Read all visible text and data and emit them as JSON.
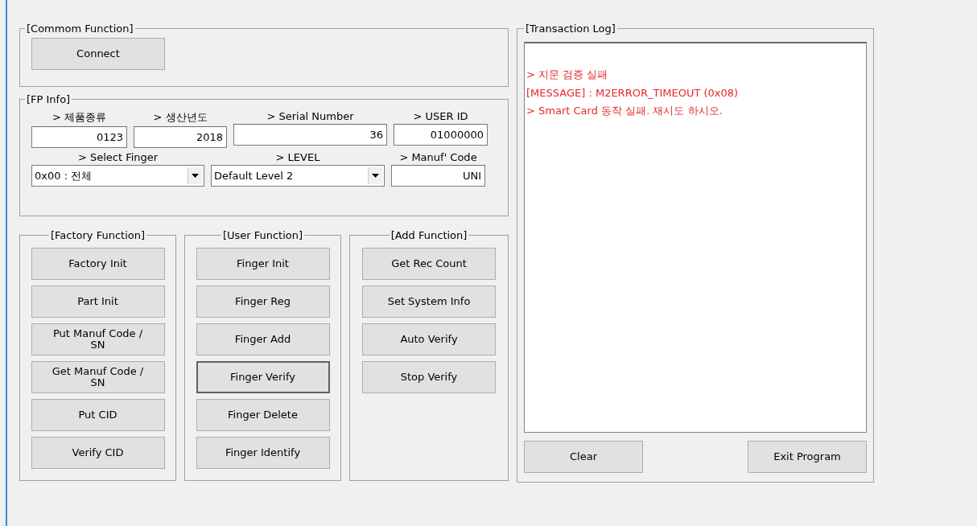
{
  "common": {
    "title": "[Commom Function]",
    "buttons": [
      {
        "label": "Connect",
        "focused": false
      }
    ]
  },
  "fp_info": {
    "title": "[FP Info]",
    "fields": [
      {
        "kind": "text",
        "label": "> 제품종류",
        "value": "0123"
      },
      {
        "kind": "text",
        "label": "> 생산년도",
        "value": "2018"
      },
      {
        "kind": "text",
        "label": "> Serial Number",
        "value": "36"
      },
      {
        "kind": "text",
        "label": "> USER ID",
        "value": "01000000"
      },
      {
        "kind": "select",
        "label": "> Select Finger",
        "value": "0x00 : 전체"
      },
      {
        "kind": "select",
        "label": "> LEVEL",
        "value": "Default Level 2"
      },
      {
        "kind": "text",
        "label": "> Manuf' Code",
        "value": "UNI"
      }
    ]
  },
  "groups": [
    {
      "title": "[Factory Function]",
      "buttons": [
        {
          "label": "Factory Init",
          "focused": false
        },
        {
          "label": "Part Init",
          "focused": false
        },
        {
          "label": "Put Manuf Code / SN",
          "focused": false
        },
        {
          "label": "Get Manuf Code / SN",
          "focused": false
        },
        {
          "label": "Put CID",
          "focused": false
        },
        {
          "label": "Verify CID",
          "focused": false
        }
      ]
    },
    {
      "title": "[User Function]",
      "buttons": [
        {
          "label": "Finger Init",
          "focused": false
        },
        {
          "label": "Finger Reg",
          "focused": false
        },
        {
          "label": "Finger Add",
          "focused": false
        },
        {
          "label": "Finger Verify",
          "focused": true
        },
        {
          "label": "Finger Delete",
          "focused": false
        },
        {
          "label": "Finger Identify",
          "focused": false
        }
      ]
    },
    {
      "title": "[Add Function]",
      "buttons": [
        {
          "label": "Get Rec Count",
          "focused": false
        },
        {
          "label": "Set System Info",
          "focused": false
        },
        {
          "label": "Auto Verify",
          "focused": false
        },
        {
          "label": "Stop Verify",
          "focused": false
        }
      ]
    }
  ],
  "log": {
    "title": "[Transaction Log]",
    "lines": [
      "> 지문 검증 실패",
      "[MESSAGE] : M2ERROR_TIMEOUT (0x08)",
      "> Smart Card 동작 실패. 재시도 하시오."
    ],
    "buttons": [
      {
        "label": "Clear",
        "focused": false
      },
      {
        "label": "Exit Program",
        "focused": false
      }
    ]
  }
}
